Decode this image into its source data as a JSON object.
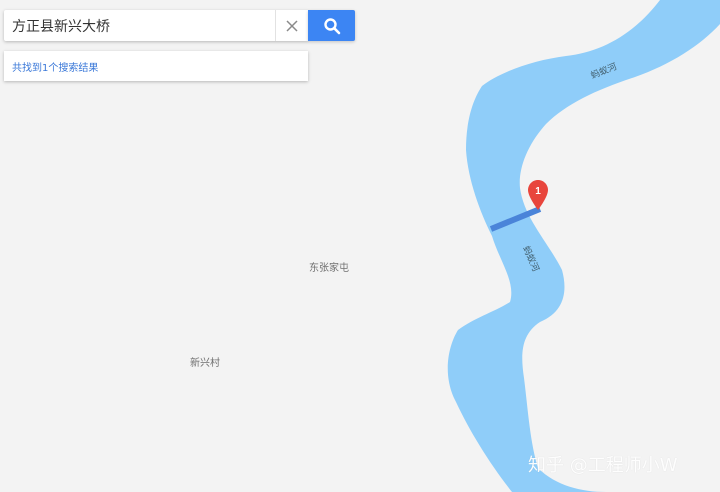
{
  "search": {
    "value": "方正县新兴大桥",
    "clear_icon": "close-icon",
    "button_icon": "search-icon"
  },
  "results": {
    "summary": "共找到1个搜索结果"
  },
  "map": {
    "places": [
      "东张家屯",
      "新兴村"
    ],
    "river_name": "蚂蚁河",
    "marker_number": "1",
    "colors": {
      "land": "#f3f3f3",
      "water": "#8fcdf9",
      "bridge": "#4a84d9",
      "marker": "#e8453c",
      "search_button": "#3c85f3"
    }
  },
  "watermark": "知乎 @工程师小W"
}
